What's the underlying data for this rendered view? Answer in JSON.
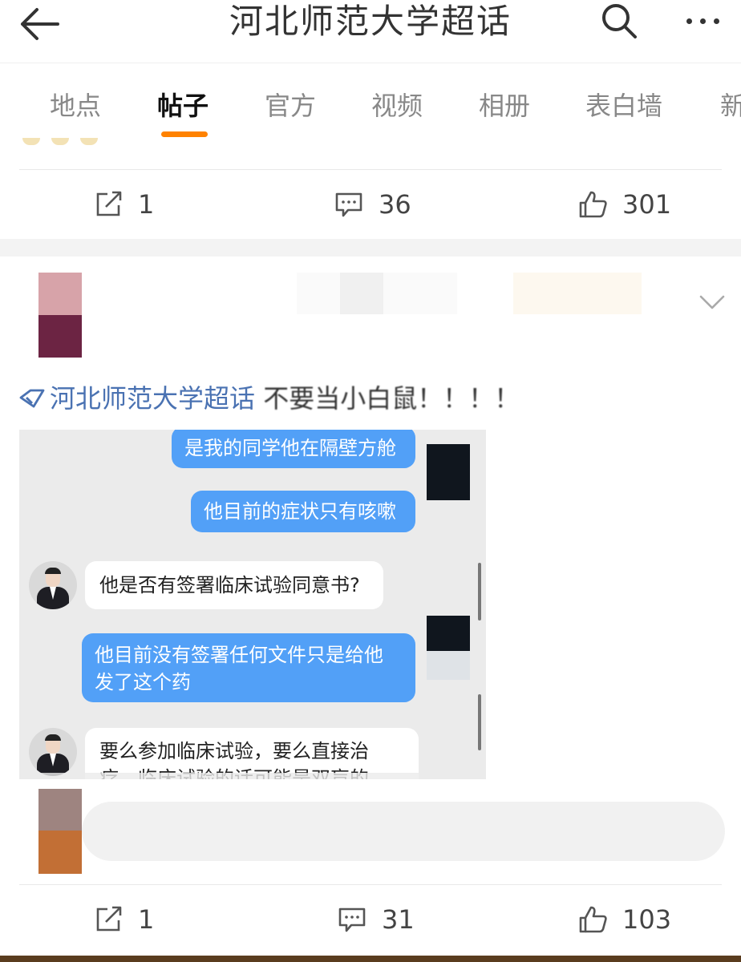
{
  "header": {
    "title": "河北师范大学超话",
    "back_icon": "back-arrow-icon",
    "search_icon": "search-icon",
    "more_icon": "more-dots-icon"
  },
  "tabs": [
    {
      "label": "地点",
      "active": false
    },
    {
      "label": "帖子",
      "active": true
    },
    {
      "label": "官方",
      "active": false
    },
    {
      "label": "视频",
      "active": false
    },
    {
      "label": "相册",
      "active": false
    },
    {
      "label": "表白墙",
      "active": false
    },
    {
      "label": "新",
      "active": false
    }
  ],
  "accent_color": "#ff8200",
  "previous_post": {
    "repost_count": "1",
    "comment_count": "36",
    "like_count": "301"
  },
  "post": {
    "topic": "河北师范大学超话",
    "text": "不要当小白鼠！！！！",
    "chat": [
      {
        "from": "me",
        "text": "是我的同学他在隔壁方舱"
      },
      {
        "from": "me",
        "text": "他目前的症状只有咳嗽"
      },
      {
        "from": "them",
        "text": "他是否有签署临床试验同意书?"
      },
      {
        "from": "me",
        "line1": "他目前没有签署任何文件只是给他",
        "line2": "发了这个药"
      },
      {
        "from": "them",
        "line1": "要么参加临床试验，要么直接治",
        "line2": "疗，临床试验的话可能是双盲的，"
      }
    ],
    "repost_count": "1",
    "comment_count": "31",
    "like_count": "103"
  }
}
